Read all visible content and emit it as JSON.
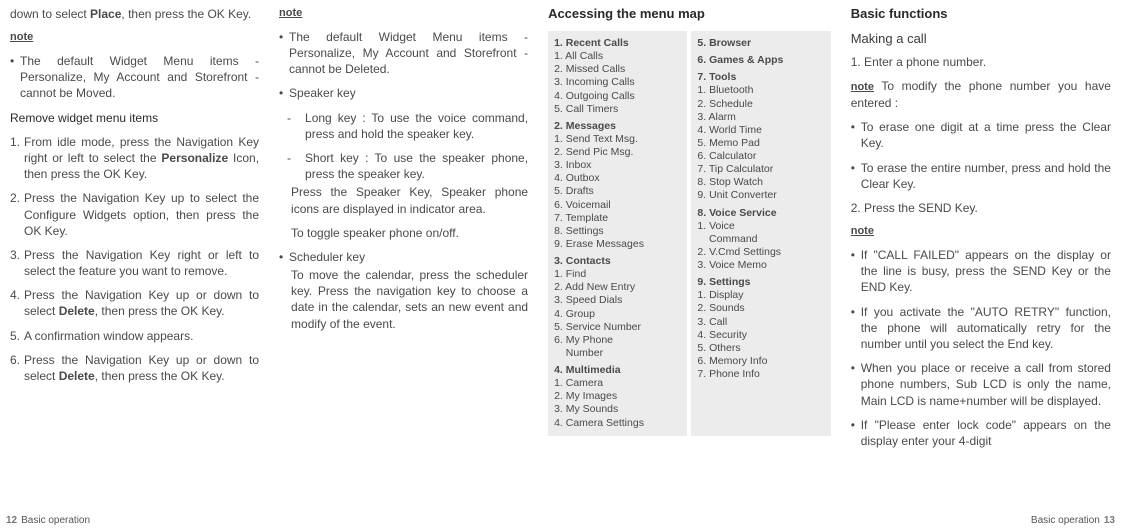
{
  "col1": {
    "intro": "down to select Place, then press the OK Key.",
    "noteH": "note",
    "note1": "The default Widget Menu items - Personalize, My Account and Storefront - cannot be Moved.",
    "subH": "Remove widget menu items",
    "s1": "From idle mode, press the Navigation Key right or left to select the Personalize Icon, then press the OK Key.",
    "s2": "Press the Navigation Key up to select the Configure Widgets option, then press the OK Key.",
    "s3": "Press the Navigation Key right or left to select the feature you want to remove.",
    "s4": "Press the Navigation Key up or down to select Delete, then press the OK Key.",
    "s5": "A confirmation window appears.",
    "s6": "Press the Navigation Key up or down to select Delete, then press the OK Key.",
    "footer": "Basic operation",
    "page": "12"
  },
  "col2": {
    "noteH": "note",
    "note1": "The default Widget Menu items - Personalize, My Account and Storefront - cannot be Deleted.",
    "b1h": "Speaker key",
    "b1a": "Long key : To use the voice command, press and hold the speaker key.",
    "b1b": "Short key : To use the speaker phone, press the speaker key.",
    "b1c": "Press the Speaker Key, Speaker phone icons are displayed in indicator area.",
    "b1d": "To toggle speaker phone on/off.",
    "b2h": "Scheduler key",
    "b2a": "To move the calendar, press the scheduler key. Press the navigation key to choose a date in the calendar, sets an new event and modify of the event."
  },
  "col3": {
    "title": "Accessing the menu map",
    "left": {
      "g1h": "1. Recent Calls",
      "g1": [
        "1. All Calls",
        "2. Missed Calls",
        "3. Incoming Calls",
        "4. Outgoing Calls",
        "5. Call Timers"
      ],
      "g2h": "2. Messages",
      "g2": [
        "1. Send Text Msg.",
        "2. Send Pic Msg.",
        "3. Inbox",
        "4. Outbox",
        "5. Drafts",
        "6. Voicemail",
        "7. Template",
        "8. Settings",
        "9. Erase Messages"
      ],
      "g3h": "3. Contacts",
      "g3": [
        "1. Find",
        "2. Add New Entry",
        "3. Speed Dials",
        "4. Group",
        "5. Service Number",
        "6. My Phone",
        "    Number"
      ],
      "g4h": "4. Multimedia",
      "g4": [
        "1. Camera",
        "2. My Images",
        "3. My Sounds",
        "4. Camera Settings"
      ]
    },
    "right": {
      "g5h": "5. Browser",
      "g6h": "6. Games & Apps",
      "g7h": "7. Tools",
      "g7": [
        "1. Bluetooth",
        "2. Schedule",
        "3. Alarm",
        "4. World Time",
        "5. Memo Pad",
        "6. Calculator",
        "7. Tip Calculator",
        "8. Stop Watch",
        "9. Unit Converter"
      ],
      "g8h": "8. Voice Service",
      "g8": [
        "1. Voice",
        "    Command",
        "2. V.Cmd Settings",
        "3. Voice Memo"
      ],
      "g9h": "9. Settings",
      "g9": [
        "1. Display",
        "2. Sounds",
        "3. Call",
        "4. Security",
        "5. Others",
        "6. Memory Info",
        "7. Phone Info"
      ]
    }
  },
  "col4": {
    "title": "Basic functions",
    "h1": "Making a call",
    "s1": "1. Enter a phone number.",
    "noteH": "note",
    "note1inline": "To modify the phone number you have entered :",
    "b1": "To erase one digit at a time press the Clear Key.",
    "b2": "To erase the entire number, press and hold the Clear Key.",
    "s2": "2. Press the SEND Key.",
    "noteH2": "note",
    "nb1": "If \"CALL FAILED\" appears on the display or the line is busy, press the SEND Key or the END Key.",
    "nb2": "If you activate the \"AUTO RETRY\" function, the phone will automatically retry for the number until you select the End key.",
    "nb3": "When you place or receive a call from stored phone numbers, Sub LCD is only the name, Main LCD is name+number will be displayed.",
    "nb4": "If \"Please enter lock code\" appears on the display enter your 4-digit",
    "footer": "Basic operation",
    "page": "13"
  }
}
